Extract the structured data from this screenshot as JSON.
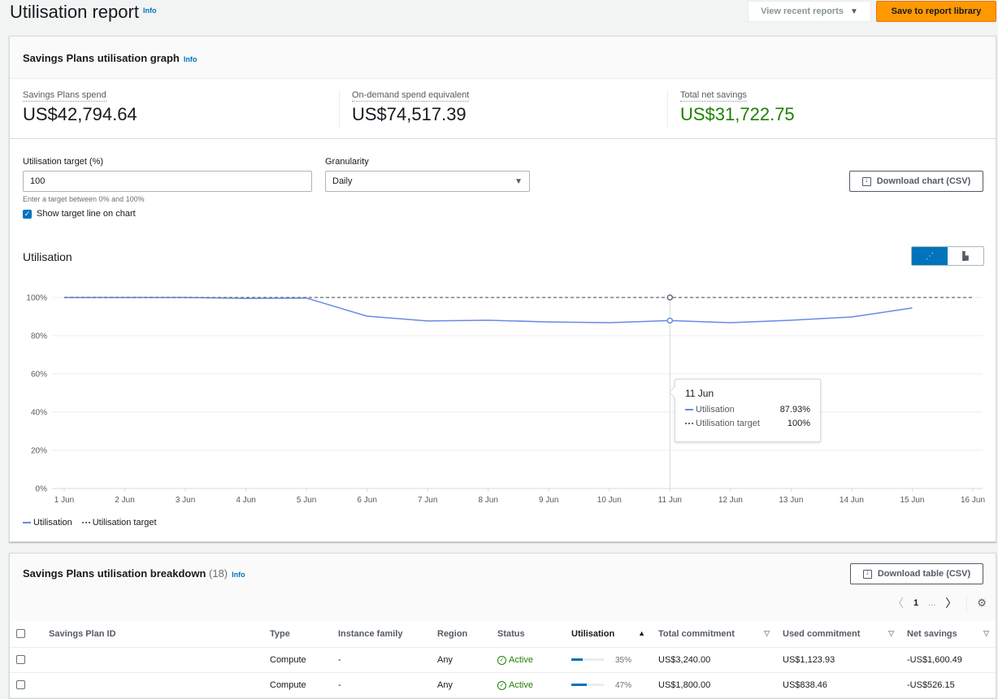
{
  "page": {
    "title": "Utilisation report",
    "info_label": "Info",
    "recent_reports_label": "View recent reports",
    "save_label": "Save to report library"
  },
  "graph_card": {
    "title": "Savings Plans utilisation graph",
    "info_label": "Info",
    "metrics": [
      {
        "label": "Savings Plans spend",
        "value": "US$42,794.64"
      },
      {
        "label": "On-demand spend equivalent",
        "value": "US$74,517.39"
      },
      {
        "label": "Total net savings",
        "value": "US$31,722.75",
        "color": "#1d8102"
      }
    ],
    "target_label": "Utilisation target (%)",
    "target_value": "100",
    "target_hint": "Enter a target between 0% and 100%",
    "show_target_label": "Show target line on chart",
    "show_target_checked": true,
    "granularity_label": "Granularity",
    "granularity_value": "Daily",
    "download_chart_label": "Download chart (CSV)",
    "chart_title": "Utilisation",
    "view_toggle": {
      "active": "line-chart",
      "options": [
        "line-chart",
        "bar-chart"
      ]
    }
  },
  "chart_data": {
    "type": "line",
    "title": "Utilisation",
    "x": [
      "1 Jun",
      "2 Jun",
      "3 Jun",
      "4 Jun",
      "5 Jun",
      "6 Jun",
      "7 Jun",
      "8 Jun",
      "9 Jun",
      "10 Jun",
      "11 Jun",
      "12 Jun",
      "13 Jun",
      "14 Jun",
      "15 Jun",
      "16 Jun"
    ],
    "series": [
      {
        "name": "Utilisation",
        "color": "#688ae8",
        "style": "solid",
        "values": [
          100,
          100,
          100,
          99.5,
          99.7,
          90.2,
          87.7,
          88.1,
          87.2,
          86.8,
          87.93,
          86.8,
          88.1,
          89.8,
          94.5,
          null
        ]
      },
      {
        "name": "Utilisation target",
        "color": "#5f6b7a",
        "style": "dashed",
        "values": [
          100,
          100,
          100,
          100,
          100,
          100,
          100,
          100,
          100,
          100,
          100,
          100,
          100,
          100,
          100,
          100
        ]
      }
    ],
    "y_ticks": [
      "0%",
      "20%",
      "40%",
      "60%",
      "80%",
      "100%"
    ],
    "ylim": [
      0,
      100
    ],
    "xlabel": "",
    "ylabel": "",
    "grid": true,
    "legend": "bottom-left",
    "highlight": {
      "x": "11 Jun",
      "title": "11 Jun",
      "rows": [
        {
          "label": "Utilisation",
          "value": "87.93%"
        },
        {
          "label": "Utilisation target",
          "value": "100%"
        }
      ]
    }
  },
  "breakdown": {
    "title": "Savings Plans utilisation breakdown",
    "count": "(18)",
    "info_label": "Info",
    "download_table_label": "Download table (CSV)",
    "pagination": {
      "current": "1",
      "ellipsis": "..."
    },
    "columns": [
      "Savings Plan ID",
      "Type",
      "Instance family",
      "Region",
      "Status",
      "Utilisation",
      "Total commitment",
      "Used commitment",
      "Net savings"
    ],
    "rows": [
      {
        "id": "",
        "type": "Compute",
        "instance_family": "-",
        "region": "Any",
        "status": "Active",
        "utilisation": "35%",
        "utilisation_fraction": 0.35,
        "total_commitment": "US$3,240.00",
        "used_commitment": "US$1,123.93",
        "net_savings": "-US$1,600.49"
      },
      {
        "id": "",
        "type": "Compute",
        "instance_family": "-",
        "region": "Any",
        "status": "Active",
        "utilisation": "47%",
        "utilisation_fraction": 0.47,
        "total_commitment": "US$1,800.00",
        "used_commitment": "US$838.46",
        "net_savings": "-US$526.15"
      }
    ]
  }
}
